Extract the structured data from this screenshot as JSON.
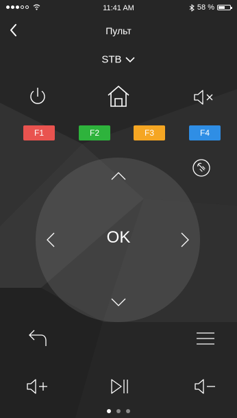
{
  "status_bar": {
    "time": "11:41 AM",
    "battery": "58 %",
    "battery_level": 0.58,
    "signal_bars_filled": 3,
    "signal_bars_total": 5
  },
  "nav": {
    "title": "Пульт",
    "back_icon": "chevron-left-icon"
  },
  "device_selector": {
    "label": "STB",
    "icon": "chevron-down-icon"
  },
  "controls": {
    "power_icon": "power-icon",
    "home_icon": "home-icon",
    "mute_icon": "mute-icon",
    "gesture_icon": "touch-gesture-icon",
    "back_icon": "return-arrow-icon",
    "menu_icon": "hamburger-menu-icon",
    "volume_up_icon": "volume-up-icon",
    "play_pause_icon": "play-pause-icon",
    "volume_down_icon": "volume-down-icon"
  },
  "function_keys": [
    {
      "label": "F1",
      "color": "#e9534f"
    },
    {
      "label": "F2",
      "color": "#2eb33c"
    },
    {
      "label": "F3",
      "color": "#f5a623"
    },
    {
      "label": "F4",
      "color": "#2f8ee5"
    }
  ],
  "dpad": {
    "ok_label": "OK"
  },
  "pager": {
    "pages": 3,
    "active": 0
  },
  "colors": {
    "background": "#2b2b2b",
    "foreground": "#ffffff"
  }
}
